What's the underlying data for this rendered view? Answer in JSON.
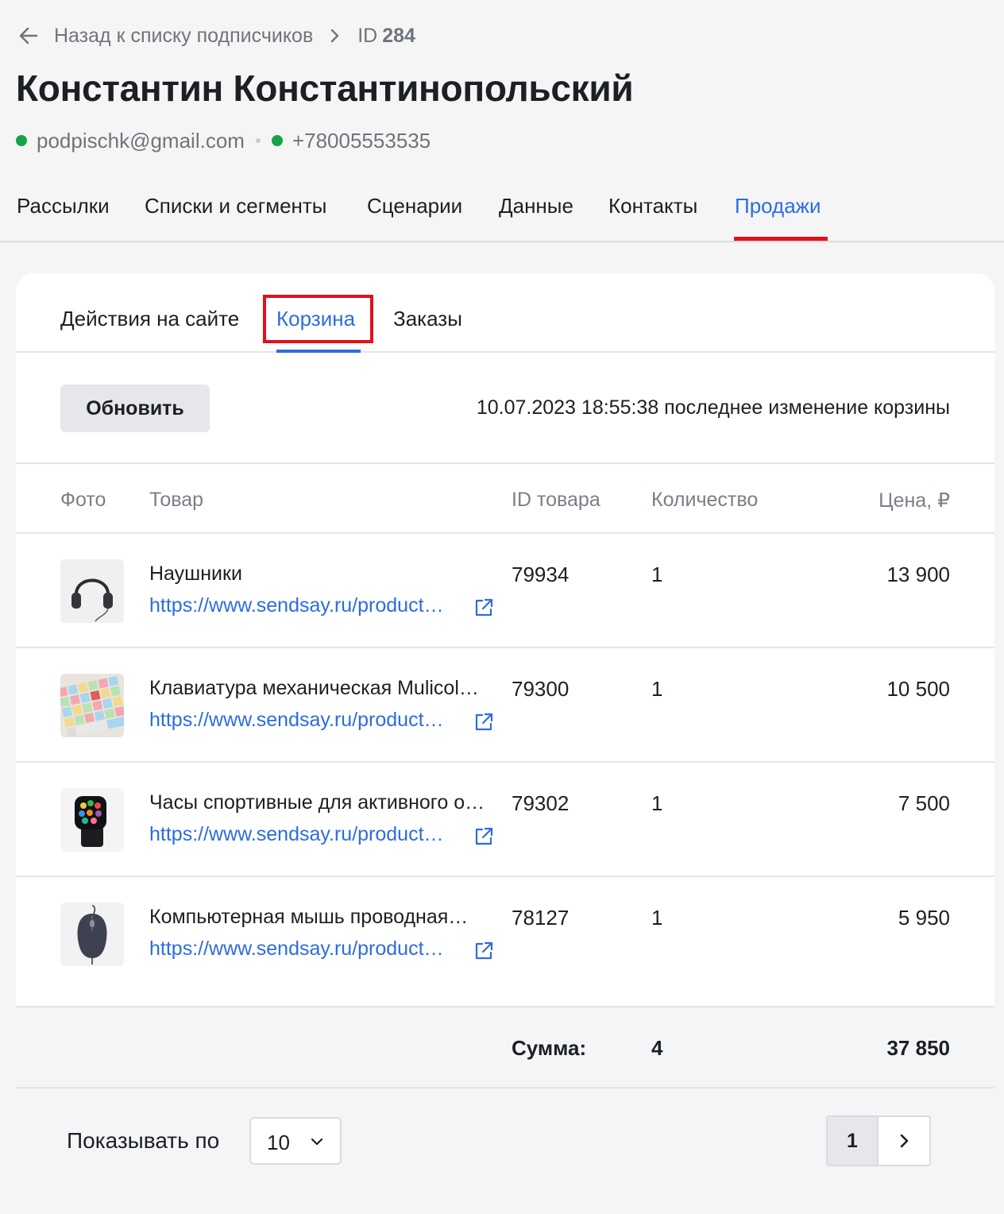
{
  "breadcrumb": {
    "back_label": "Назад к списку подписчиков",
    "id_prefix": "ID",
    "id_value": "284"
  },
  "subscriber": {
    "name": "Константин Константинопольский",
    "email": "podpischk@gmail.com",
    "phone": "+78005553535"
  },
  "main_tabs": [
    {
      "label": "Рассылки"
    },
    {
      "label": "Списки и сегменты"
    },
    {
      "label": "Сценарии"
    },
    {
      "label": "Данные"
    },
    {
      "label": "Контакты"
    },
    {
      "label": "Продажи",
      "active": true
    }
  ],
  "sub_tabs": [
    {
      "label": "Действия на сайте"
    },
    {
      "label": "Корзина",
      "active": true
    },
    {
      "label": "Заказы"
    }
  ],
  "toolbar": {
    "refresh_label": "Обновить",
    "last_change": "10.07.2023 18:55:38 последнее изменение корзины"
  },
  "table": {
    "headers": {
      "photo": "Фото",
      "product": "Товар",
      "product_id": "ID товара",
      "quantity": "Количество",
      "price": "Цена, ₽"
    },
    "rows": [
      {
        "name": "Наушники",
        "link": "https://www.sendsay.ru/product…",
        "id": "79934",
        "qty": "1",
        "price": "13 900",
        "image": "headphones"
      },
      {
        "name": "Клавиатура механическая Mulicol…",
        "link": "https://www.sendsay.ru/product…",
        "id": "79300",
        "qty": "1",
        "price": "10 500",
        "image": "keyboard"
      },
      {
        "name": "Часы спортивные для активного о…",
        "link": "https://www.sendsay.ru/product…",
        "id": "79302",
        "qty": "1",
        "price": "7 500",
        "image": "smartwatch"
      },
      {
        "name": "Компьютерная мышь проводная…",
        "link": "https://www.sendsay.ru/product…",
        "id": "78127",
        "qty": "1",
        "price": "5 950",
        "image": "mouse"
      }
    ],
    "summary": {
      "label": "Сумма:",
      "qty": "4",
      "price": "37 850"
    }
  },
  "pagination": {
    "show_label": "Показывать по",
    "page_size": "10",
    "current_page": "1"
  },
  "colors": {
    "accent": "#2d6cdf",
    "highlight": "#e3101c",
    "status_green": "#17a34a"
  },
  "icons": [
    "arrow-left-icon",
    "chevron-right-icon",
    "external-link-icon",
    "chevron-down-icon"
  ]
}
